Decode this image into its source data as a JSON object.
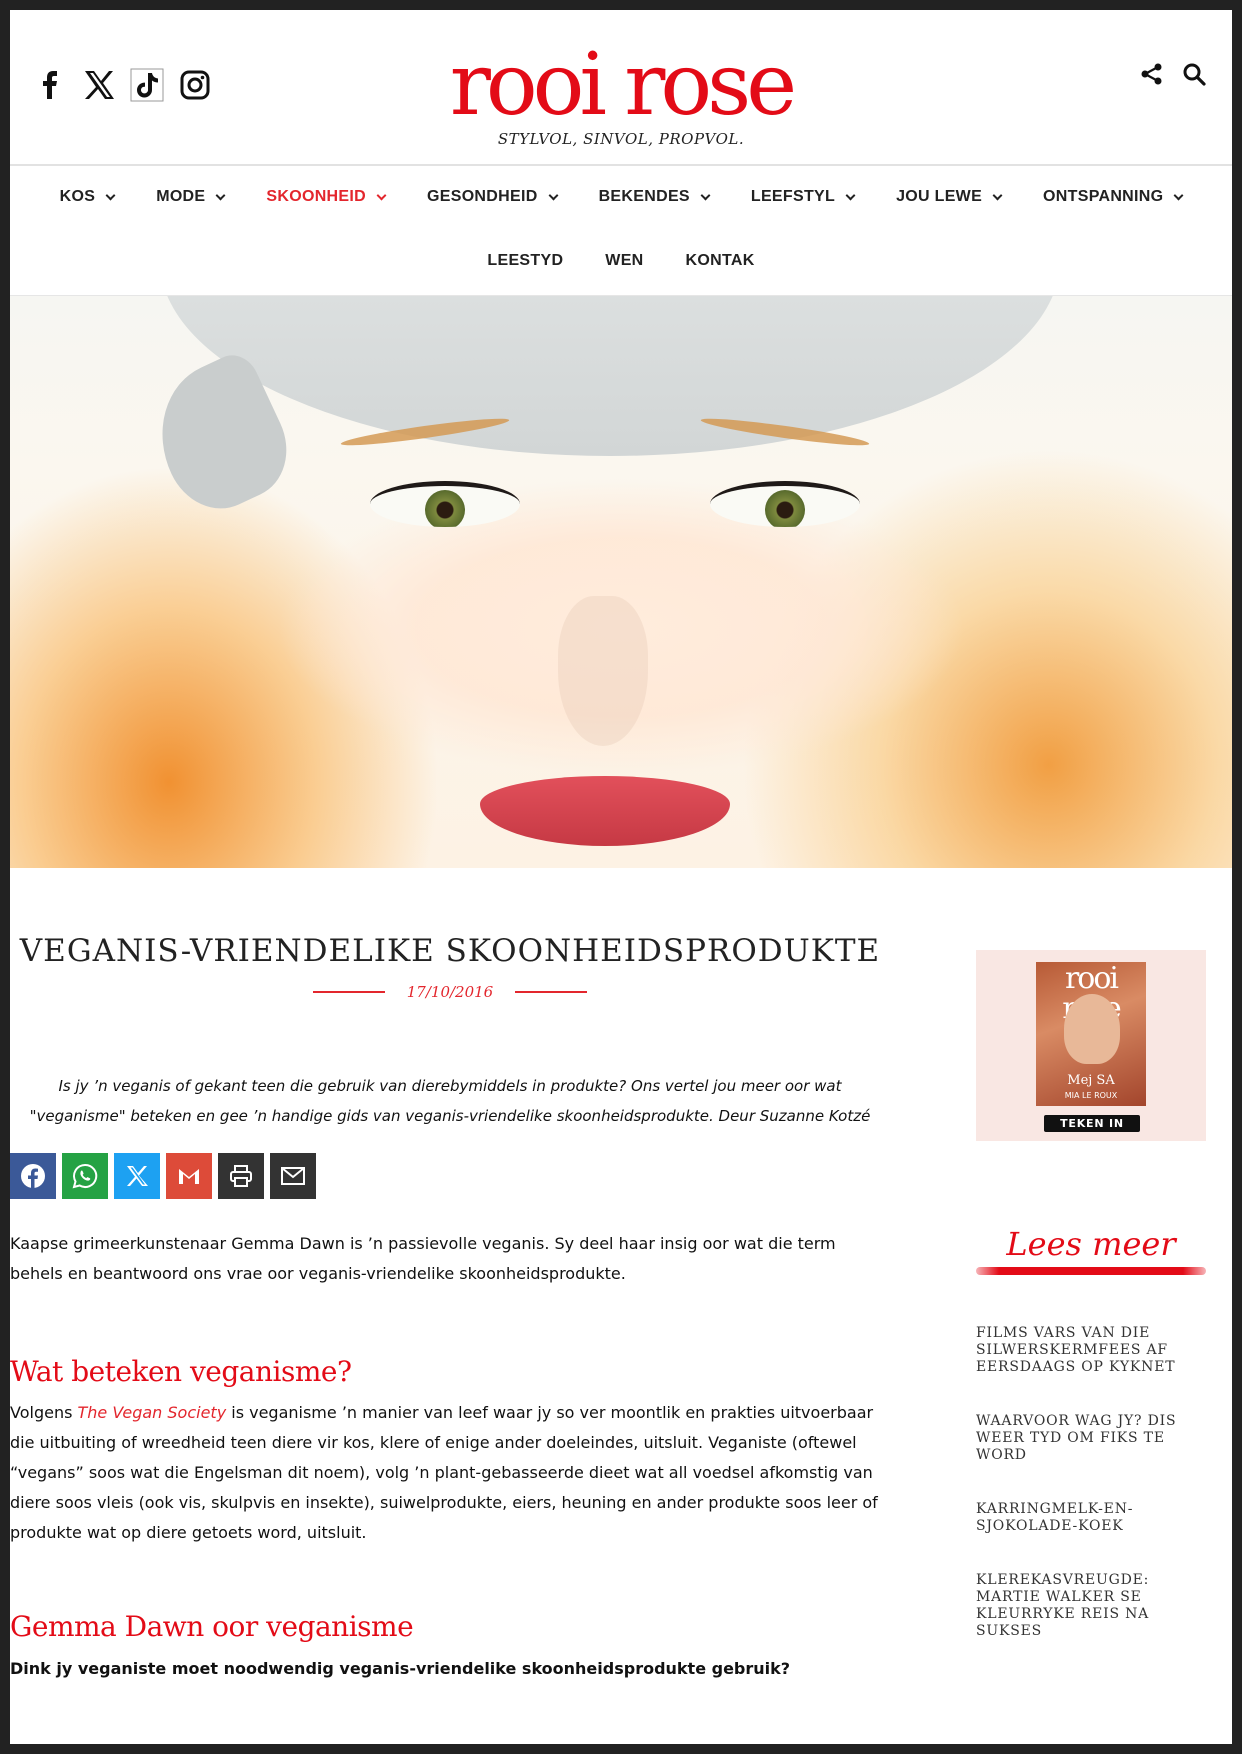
{
  "brand": {
    "logo": "rooi rose",
    "tagline": "STYLVOL, SINVOL, PROPVOL."
  },
  "social_icons": [
    "facebook-icon",
    "x-icon",
    "tiktok-icon",
    "instagram-icon"
  ],
  "nav": {
    "row1": [
      {
        "label": "KOS",
        "dropdown": true
      },
      {
        "label": "MODE",
        "dropdown": true
      },
      {
        "label": "SKOONHEID",
        "dropdown": true,
        "active": true
      },
      {
        "label": "GESONDHEID",
        "dropdown": true
      },
      {
        "label": "BEKENDES",
        "dropdown": true
      },
      {
        "label": "LEEFSTYL",
        "dropdown": true
      },
      {
        "label": "JOU LEWE",
        "dropdown": true
      },
      {
        "label": "ONTSPANNING",
        "dropdown": true
      }
    ],
    "row2": [
      {
        "label": "LEESTYD"
      },
      {
        "label": "WEN"
      },
      {
        "label": "KONTAK"
      }
    ]
  },
  "article": {
    "title": "VEGANIS-VRIENDELIKE SKOONHEIDSPRODUKTE",
    "date": "17/10/2016",
    "lede": "Is jy ’n veganis of gekant teen die gebruik van dierebymiddels in produkte? Ons vertel jou meer oor wat \"veganisme\" beteken en gee ’n handige gids van veganis-vriendelike skoonheidsprodukte. Deur Suzanne Kotzé",
    "share": [
      {
        "name": "facebook",
        "color": "#3b5998"
      },
      {
        "name": "whatsapp",
        "color": "#25a244"
      },
      {
        "name": "x",
        "color": "#1da1f2"
      },
      {
        "name": "gmail",
        "color": "#dd4b39"
      },
      {
        "name": "print",
        "color": "#333333"
      },
      {
        "name": "email",
        "color": "#333333"
      }
    ],
    "intro": "Kaapse grimeerkunstenaar Gemma Dawn is ’n passievolle veganis. Sy deel haar insig oor wat die term behels en beantwoord ons vrae oor veganis-vriendelike skoonheidsprodukte.",
    "h2_1": "Wat beteken veganisme?",
    "p2_before": "Volgens ",
    "p2_link": "The Vegan Society",
    "p2_after": " is veganisme ’n manier van leef waar jy so ver moontlik en prakties uitvoerbaar die uitbuiting of wreedheid teen diere vir kos, klere of enige ander doeleindes, uitsluit. Veganiste (oftewel “vegans” soos wat die Engelsman dit noem), volg ’n plant-gebasseerde dieet wat all voedsel afkomstig van diere soos vleis (ook vis, skulpvis en insekte), suiwelprodukte, eiers, heuning en ander produkte soos leer of produkte wat op diere getoets word, uitsluit.",
    "h2_2": "Gemma Dawn oor veganisme",
    "question": "Dink jy veganiste moet noodwendig veganis-vriendelike skoonheidsprodukte gebruik?"
  },
  "sidebar": {
    "magazine": {
      "logo": "rooi rose",
      "cover_name": "MIA LE ROUX",
      "cover_title": "Mej SA",
      "cta": "TEKEN IN"
    },
    "lees_meer": "Lees meer",
    "links": [
      "FILMS VARS VAN DIE SILWERSKERMFEES AF EERSDAAGS OP KYKNET",
      "WAARVOOR WAG JY? DIS WEER TYD OM FIKS TE WORD",
      "KARRINGMELK-EN-SJOKOLADE-KOEK",
      "KLEREKASVREUGDE: MARTIE WALKER SE KLEURRYKE REIS NA SUKSES"
    ]
  },
  "colors": {
    "brand_red": "#e30b17",
    "accent_red": "#e3262d"
  }
}
